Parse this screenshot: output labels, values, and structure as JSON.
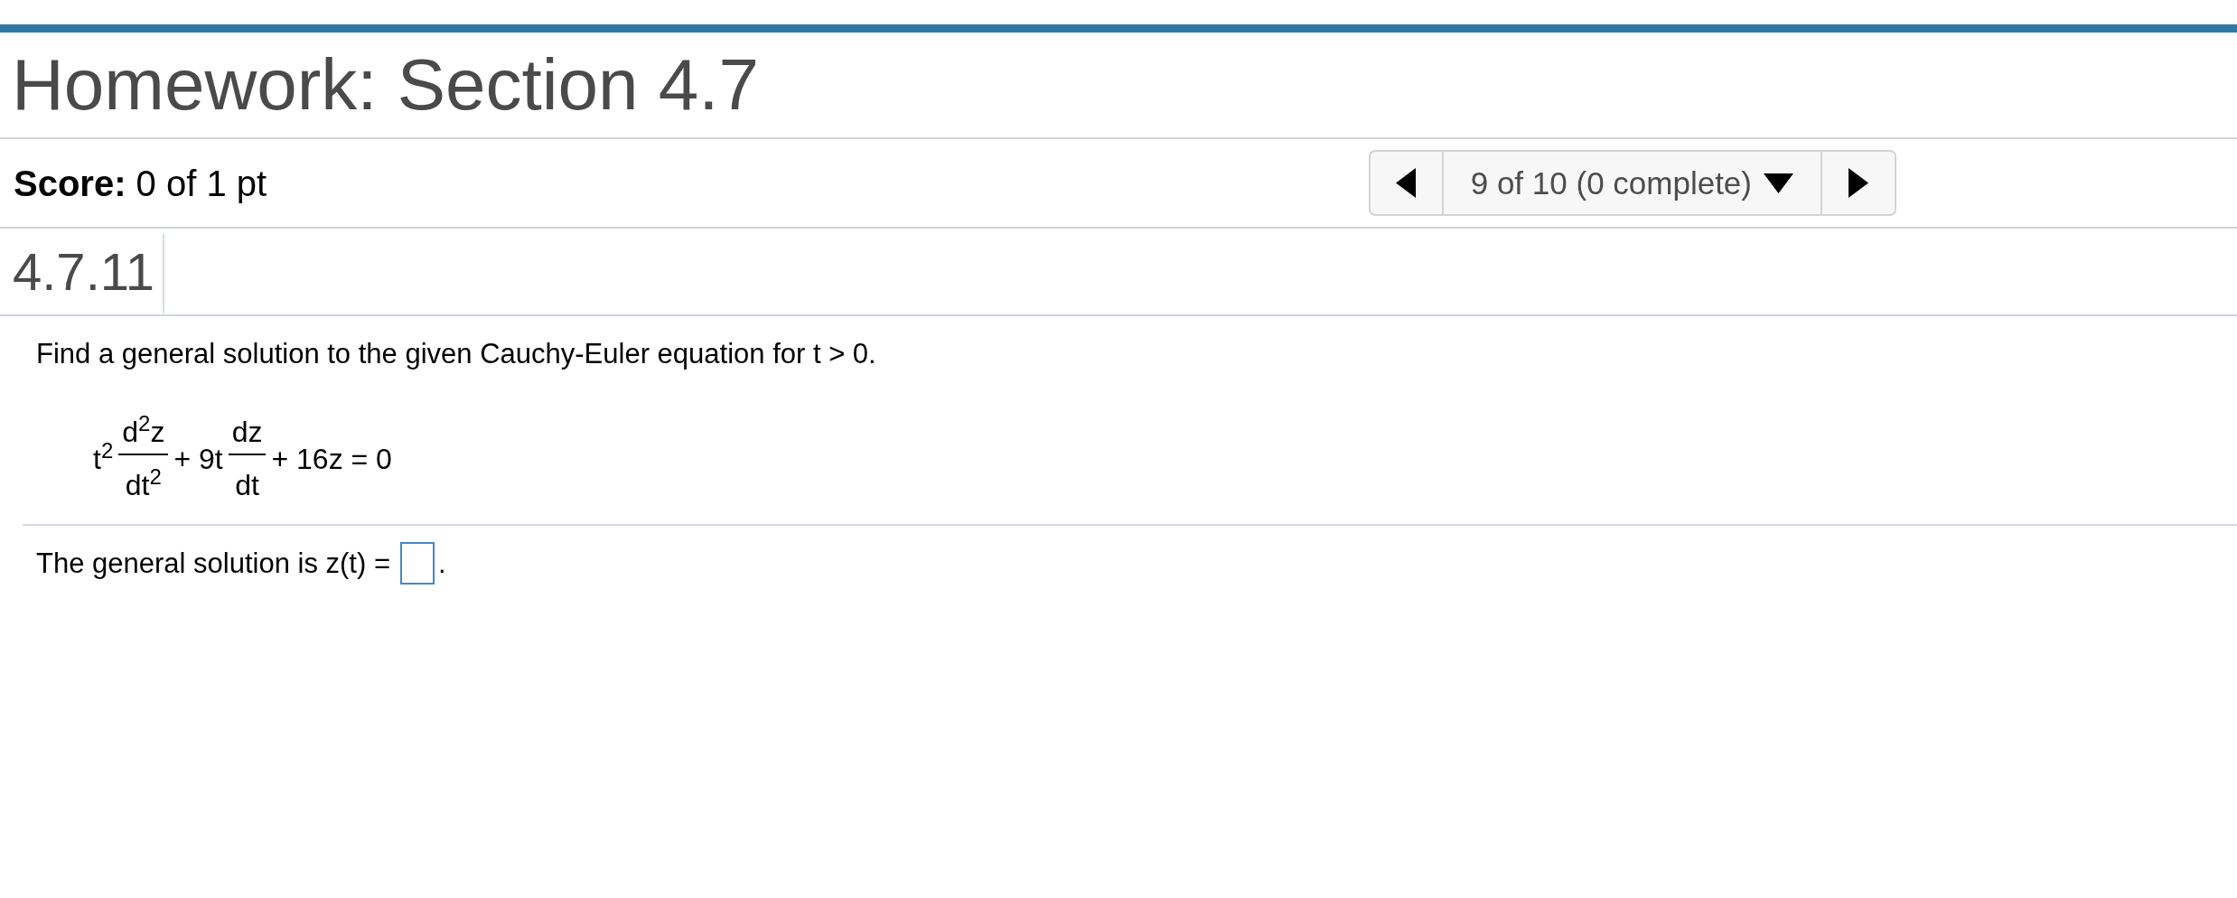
{
  "page": {
    "title": "Homework: Section 4.7"
  },
  "score": {
    "text": "**Score:** 0 of 1 pt"
  },
  "question_nav": {
    "position": "9 of 10 (0 complete)"
  },
  "problem": {
    "number": "4.7.11",
    "instruction": "Find a general solution to the given Cauchy-Euler equation for t > 0.",
    "equation": [
      {
        "kind": "text",
        "text": "t$^{2}$"
      },
      {
        "kind": "fraction",
        "numerator": "d$^{2}$z",
        "denominator": "dt$^{2}$"
      },
      {
        "kind": "text",
        "text": "+ 9t"
      },
      {
        "kind": "fraction",
        "numerator": "dz",
        "denominator": "dt"
      },
      {
        "kind": "text",
        "text": "+ 16z = 0"
      }
    ],
    "answer": {
      "prompt": "The general solution is z(t) =",
      "suffix": "."
    }
  }
}
